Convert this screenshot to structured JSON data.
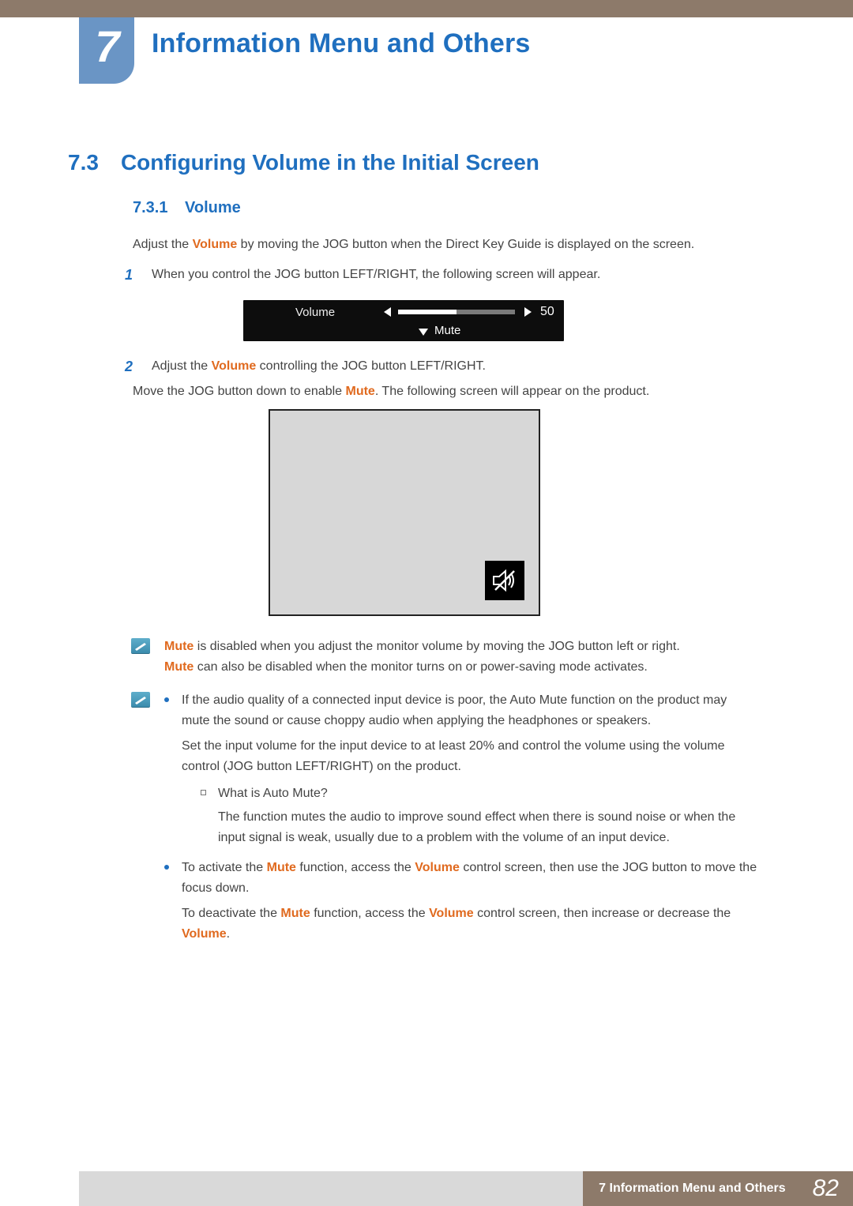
{
  "chapter": {
    "number": "7",
    "title": "Information Menu and Others"
  },
  "section": {
    "number": "7.3",
    "title": "Configuring Volume in the Initial Screen"
  },
  "subsection": {
    "number": "7.3.1",
    "title": "Volume"
  },
  "intro": {
    "pre": "Adjust the ",
    "kw": "Volume",
    "post": " by moving the JOG button when the Direct Key Guide is displayed on the screen."
  },
  "steps": {
    "s1": {
      "num": "1",
      "text": "When you control the JOG button LEFT/RIGHT, the following screen will appear."
    },
    "s2": {
      "num": "2",
      "pre": "Adjust the ",
      "kw": "Volume",
      "post": " controlling the JOG button LEFT/RIGHT."
    }
  },
  "osd": {
    "label": "Volume",
    "value": "50",
    "fill_percent": 50,
    "mute_label": "Mute"
  },
  "mute_line": {
    "pre": "Move the JOG button down to enable ",
    "kw": "Mute",
    "post": ". The following screen will appear on the product."
  },
  "note1": {
    "line1": {
      "kw": "Mute",
      "post": " is disabled when you adjust the monitor volume by moving the JOG button left or right."
    },
    "line2": {
      "kw": "Mute",
      "post": " can also be disabled when the monitor turns on or power-saving mode activates."
    }
  },
  "note2": {
    "b1": {
      "p1": "If the audio quality of a connected input device is poor, the Auto Mute function on the product may mute the sound or cause choppy audio when applying the headphones or speakers.",
      "p2": "Set the input volume for the input device to at least 20% and control the volume using the volume control (JOG button LEFT/RIGHT) on the product.",
      "sub_q": "What is Auto Mute?",
      "sub_a": "The function mutes the audio to improve sound effect when there is sound noise or when the input signal is weak, usually due to a problem with the volume of an input device."
    },
    "b2": {
      "p1_pre": "To activate the ",
      "p1_kw1": "Mute",
      "p1_mid": " function, access the ",
      "p1_kw2": "Volume",
      "p1_post": " control screen, then use the JOG button to move the focus down.",
      "p2_pre": "To deactivate the ",
      "p2_kw1": "Mute",
      "p2_mid": " function, access the ",
      "p2_kw2": "Volume",
      "p2_post": " control screen, then increase or decrease the ",
      "p2_kw3": "Volume",
      "p2_end": "."
    }
  },
  "footer": {
    "label": "7 Information Menu and Others",
    "page": "82"
  }
}
